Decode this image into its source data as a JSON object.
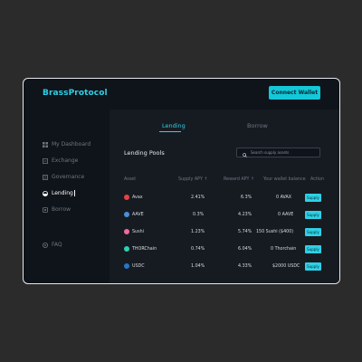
{
  "app": {
    "brand": "BrassProtocol",
    "connect_label": "Connect Wallet"
  },
  "sidebar": {
    "items": [
      {
        "label": "My Dashboard",
        "icon": "grid-icon"
      },
      {
        "label": "Exchange",
        "icon": "exchange-icon"
      },
      {
        "label": "Governance",
        "icon": "governance-icon"
      },
      {
        "label": "Lending",
        "icon": "lending-icon",
        "active": true
      },
      {
        "label": "Borrow",
        "icon": "borrow-icon"
      },
      {
        "label": "FAQ",
        "icon": "question-icon"
      }
    ]
  },
  "main": {
    "tabs": [
      {
        "label": "Lending",
        "active": true
      },
      {
        "label": "Borrow"
      }
    ],
    "pools_title": "Lending Pools",
    "search_placeholder": "Search supply assets",
    "columns": [
      "Asset",
      "Supply APY ↑",
      "Reward APY ↑",
      "Your wallet balance",
      "Action"
    ],
    "rows": [
      {
        "asset": "Avax",
        "supply_apy": "2.41%",
        "reward_apy": "6.3%",
        "balance": "0 AVAX",
        "action": "Supply",
        "color": "#e84142"
      },
      {
        "asset": "AAVE",
        "supply_apy": "0.3%",
        "reward_apy": "4.23%",
        "balance": "0 AAVE",
        "action": "Supply",
        "color": "#4a8fd9"
      },
      {
        "asset": "Sushi",
        "supply_apy": "1.23%",
        "reward_apy": "5.74%",
        "balance": "150 Sushi ($400)",
        "action": "Supply",
        "color": "#f06aa0"
      },
      {
        "asset": "THORChain",
        "supply_apy": "0.74%",
        "reward_apy": "6.04%",
        "balance": "0 Thorchain",
        "action": "Supply",
        "color": "#2ed1b6"
      },
      {
        "asset": "USDC",
        "supply_apy": "1.04%",
        "reward_apy": "4.33%",
        "balance": "$2000 USDC",
        "action": "Supply",
        "color": "#2775ca"
      }
    ]
  }
}
